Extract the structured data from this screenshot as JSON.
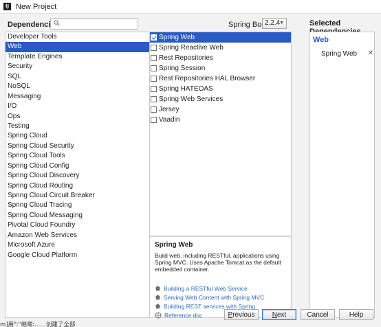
{
  "window": {
    "title": "New Project",
    "app_icon_glyph": "IJ"
  },
  "header": {
    "dependencies_label": "Dependencies",
    "search": {
      "value": "",
      "placeholder": ""
    },
    "spring_boot_label": "Spring Boot",
    "spring_boot_version": "2.2.4",
    "selected_dependencies_label": "Selected Dependencies"
  },
  "categories": [
    "Developer Tools",
    "Web",
    "Template Engines",
    "Security",
    "SQL",
    "NoSQL",
    "Messaging",
    "I/O",
    "Ops",
    "Testing",
    "Spring Cloud",
    "Spring Cloud Security",
    "Spring Cloud Tools",
    "Spring Cloud Config",
    "Spring Cloud Discovery",
    "Spring Cloud Routing",
    "Spring Cloud Circuit Breaker",
    "Spring Cloud Tracing",
    "Spring Cloud Messaging",
    "Pivotal Cloud Foundry",
    "Amazon Web Services",
    "Microsoft Azure",
    "Google Cloud Platform"
  ],
  "selected_category": "Web",
  "dependencies": [
    {
      "label": "Spring Web",
      "checked": true
    },
    {
      "label": "Spring Reactive Web",
      "checked": false
    },
    {
      "label": "Rest Repositories",
      "checked": false
    },
    {
      "label": "Spring Session",
      "checked": false
    },
    {
      "label": "Rest Repositories HAL Browser",
      "checked": false
    },
    {
      "label": "Spring HATEOAS",
      "checked": false
    },
    {
      "label": "Spring Web Services",
      "checked": false
    },
    {
      "label": "Jersey",
      "checked": false
    },
    {
      "label": "Vaadin",
      "checked": false
    }
  ],
  "details": {
    "title": "Spring Web",
    "description": "Build web, including RESTful, applications using Spring MVC. Uses Apache Tomcat as the default embedded container.",
    "links": [
      {
        "label": "Building a RESTful Web Service",
        "icon": "home-icon"
      },
      {
        "label": "Serving Web Content with Spring MVC",
        "icon": "home-icon"
      },
      {
        "label": "Building REST services with Spring",
        "icon": "home-icon"
      },
      {
        "label": "Reference doc",
        "icon": "reference-doc-icon"
      }
    ]
  },
  "selected_panel": {
    "group": "Web",
    "items": [
      {
        "label": "Spring Web",
        "remove_glyph": "✕"
      }
    ]
  },
  "background_text": "m]用\"∶“继嗯∶……创建了全部",
  "buttons": {
    "previous": {
      "pre": "",
      "mnemonic": "P",
      "post": "revious"
    },
    "next": {
      "pre": "",
      "mnemonic": "N",
      "post": "ext"
    },
    "cancel": {
      "label": "Cancel"
    },
    "help": {
      "label": "Help"
    }
  },
  "colors": {
    "selection": "#2a5ac6",
    "link": "#2a6ac0"
  }
}
